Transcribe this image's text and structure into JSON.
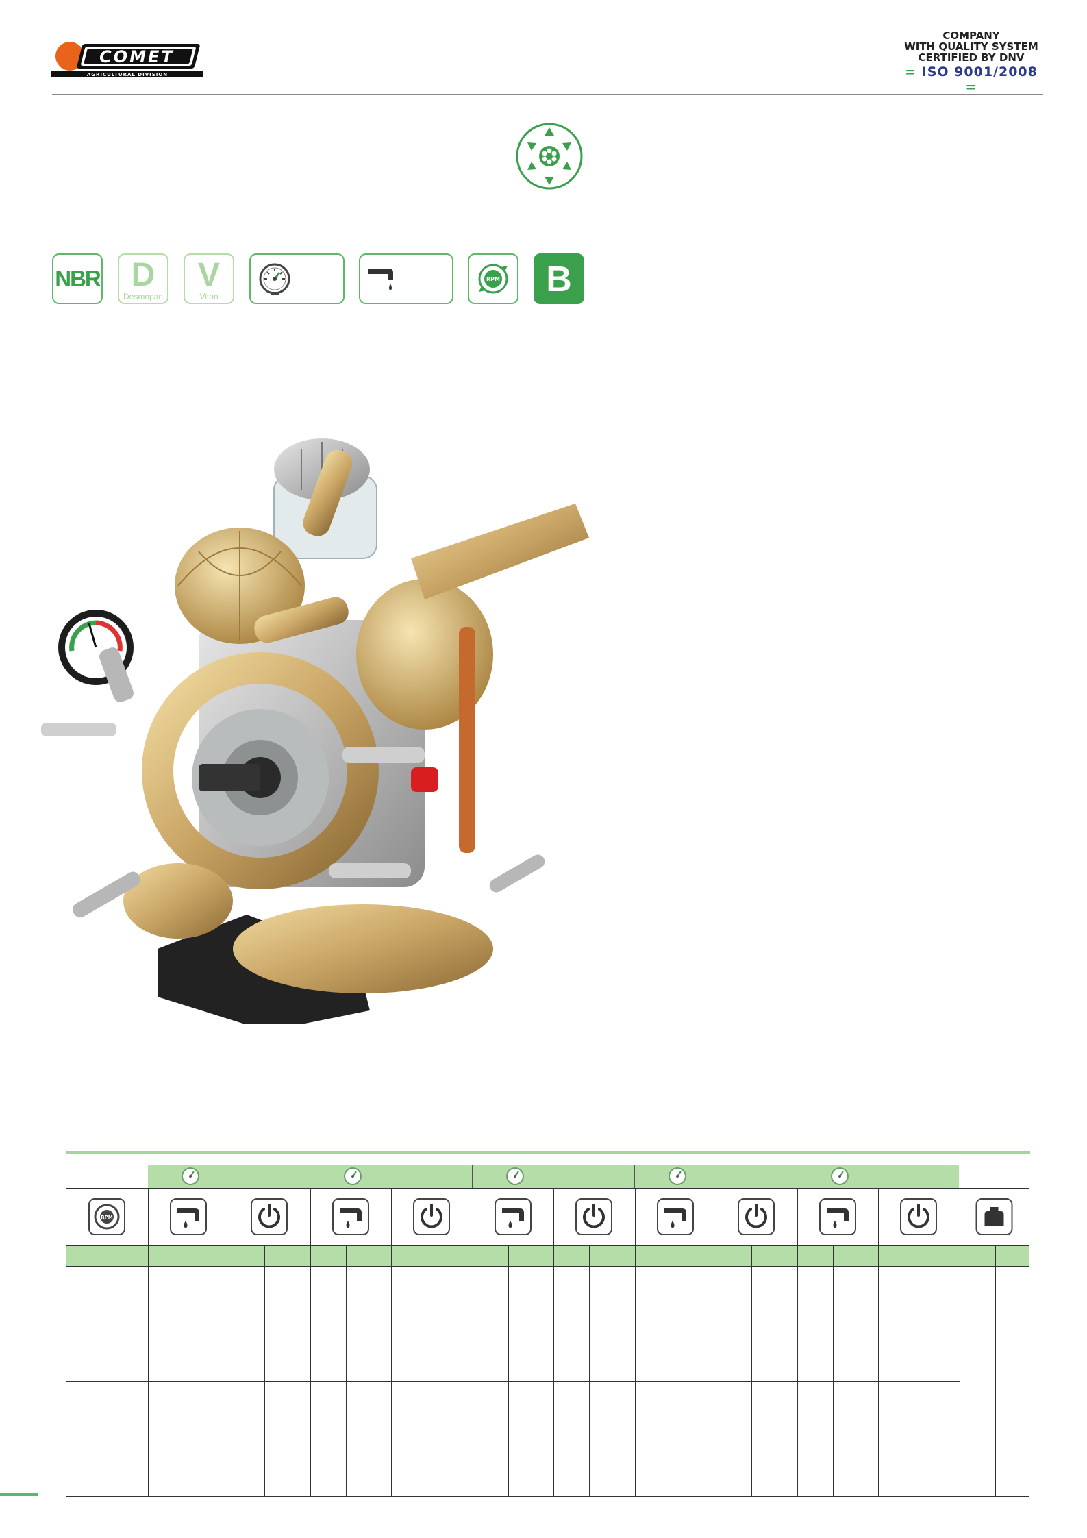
{
  "header": {
    "brand": "COMET",
    "division": "AGRICULTURAL DIVISION",
    "certification": {
      "line1": "COMPANY",
      "line2": "WITH QUALITY SYSTEM",
      "line3": "CERTIFIED BY DNV",
      "iso": "ISO 9001/2008"
    }
  },
  "emblem": {
    "icon": "diaphragm-pump-icon",
    "color": "#3aa04b"
  },
  "features": [
    {
      "id": "nbr",
      "label": "NBR",
      "sub": "",
      "style": "outline"
    },
    {
      "id": "desmopan",
      "label": "D",
      "sub": "Desmopan",
      "style": "faded"
    },
    {
      "id": "viton",
      "label": "V",
      "sub": "Viton",
      "style": "faded"
    },
    {
      "id": "pressure",
      "icon": "pressure-gauge-icon",
      "label": "",
      "style": "outline"
    },
    {
      "id": "flow",
      "icon": "flow-tap-icon",
      "label": "",
      "style": "outline"
    },
    {
      "id": "rpm",
      "icon": "rpm-icon",
      "label": "",
      "style": "outline"
    },
    {
      "id": "version",
      "label": "B",
      "sub": "",
      "style": "filled"
    }
  ],
  "image": {
    "subject": "diaphragm-pump-image"
  },
  "table": {
    "pressure_groups": 5,
    "header_icons": [
      "rpm-icon",
      "flow-tap-icon",
      "power-icon",
      "weight-icon"
    ],
    "rows": 4
  },
  "colors": {
    "accent": "#5fb86a",
    "accent_light": "#b5dda8",
    "iso_blue": "#2b3a8c"
  }
}
